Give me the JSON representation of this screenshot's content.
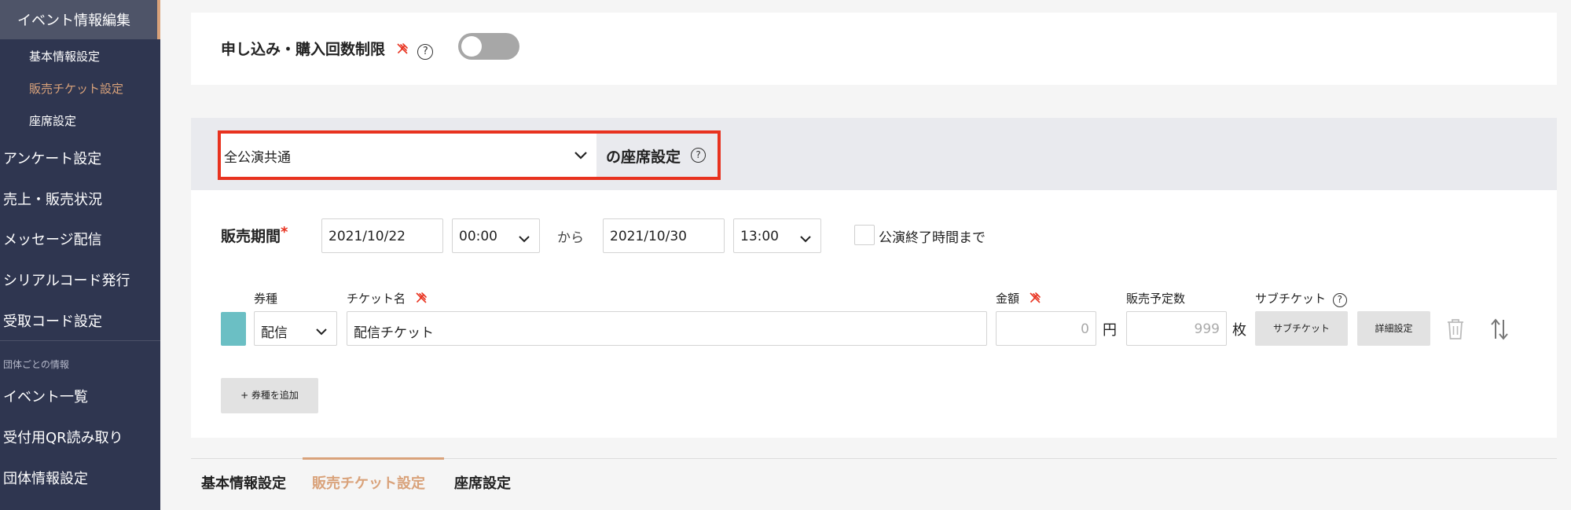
{
  "sidebar": {
    "active": "イベント情報編集",
    "sub_items": [
      "基本情報設定",
      "販売チケット設定",
      "座席設定"
    ],
    "items": [
      "アンケート設定",
      "売上・販売状況",
      "メッセージ配信",
      "シリアルコード発行",
      "受取コード設定"
    ],
    "section_label": "団体ごとの情報",
    "group_items": [
      "イベント一覧",
      "受付用QR読み取り",
      "団体情報設定"
    ]
  },
  "limit": {
    "label": "申し込み・購入回数制限",
    "help": "?",
    "enabled": false
  },
  "seat": {
    "select_value": "全公演共通",
    "label": "の座席設定",
    "help": "?"
  },
  "period": {
    "label": "販売期間",
    "required_mark": "*",
    "start_date": "2021/10/22",
    "start_time": "00:00",
    "from_text": "から",
    "end_date": "2021/10/30",
    "end_time": "13:00",
    "until_end_label": "公演終了時間まで"
  },
  "ticket": {
    "headers": {
      "type": "券種",
      "name": "チケット名",
      "price": "金額",
      "quantity": "販売予定数",
      "sub": "サブチケット",
      "sub_help": "?"
    },
    "type_value": "配信",
    "name_value": "配信チケット",
    "price_placeholder": "0",
    "price_unit": "円",
    "quantity_placeholder": "999",
    "quantity_unit": "枚",
    "sub_button": "サブチケット",
    "detail_button": "詳細設定",
    "chip_color": "#6bbfc4"
  },
  "add_type_button": "+ 券種を追加",
  "tabs": [
    "基本情報設定",
    "販売チケット設定",
    "座席設定"
  ],
  "colors": {
    "sidebar_bg": "#2f3650",
    "accent": "#d9a27a",
    "highlight_border": "#e8321f"
  }
}
